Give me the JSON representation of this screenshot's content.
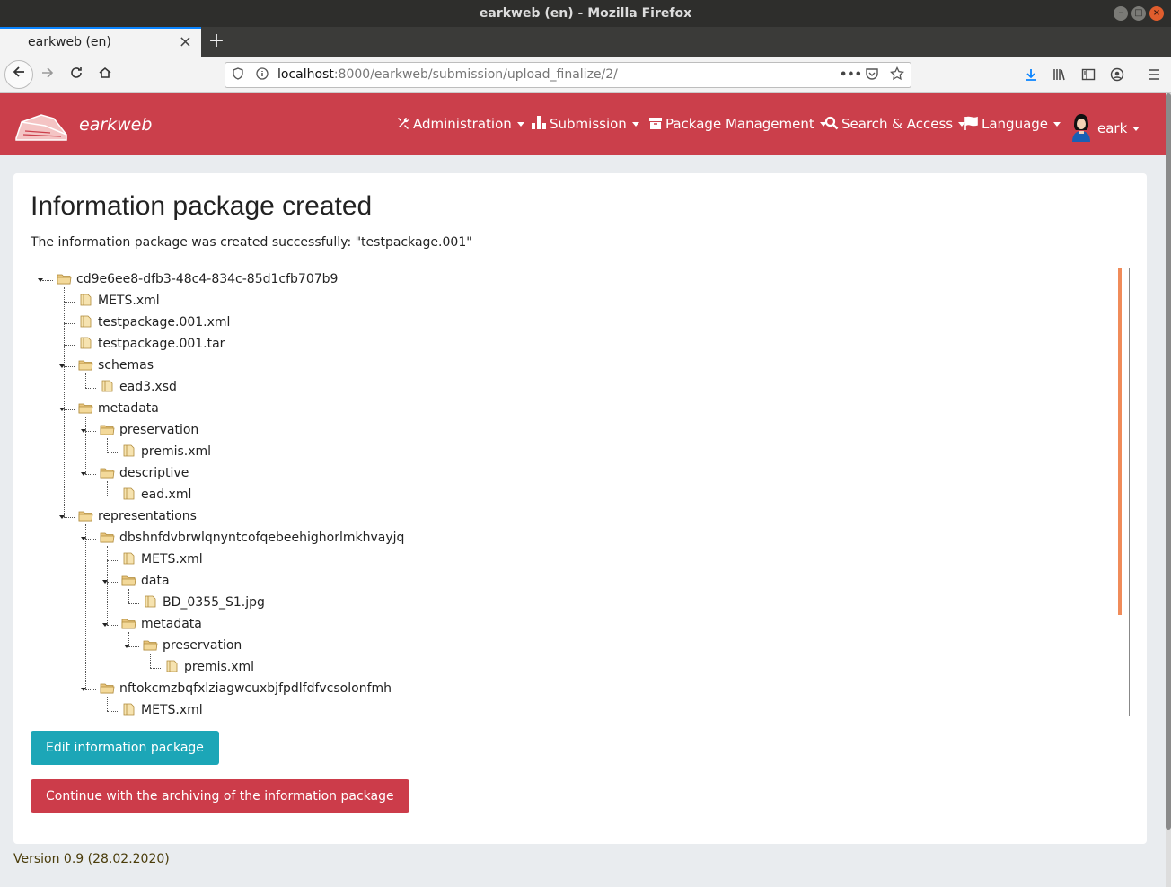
{
  "window": {
    "title": "earkweb (en) - Mozilla Firefox",
    "buttons": [
      "–",
      "□",
      "×"
    ]
  },
  "browser": {
    "tab_title": "earkweb (en)",
    "tab_close": "×",
    "new_tab": "+",
    "url_host": "localhost",
    "url_rest": ":8000/earkweb/submission/upload_finalize/2/",
    "icons": [
      "back-icon",
      "forward-icon",
      "reload-icon",
      "home-icon",
      "shield-icon",
      "info-icon",
      "more-icon",
      "pocket-icon",
      "bookmark-star-icon",
      "download-icon",
      "library-icon",
      "sidebar-icon",
      "account-icon",
      "hamburger-menu-icon"
    ]
  },
  "app": {
    "brand": "earkweb",
    "brand_color": "#cb3f4b",
    "menu": [
      {
        "label": "Administration",
        "icon": "tools-icon"
      },
      {
        "label": "Submission",
        "icon": "submission-icon"
      },
      {
        "label": "Package Management",
        "icon": "archive-box-icon"
      },
      {
        "label": "Search & Access",
        "icon": "search-icon"
      },
      {
        "label": "Language",
        "icon": "flag-icon"
      },
      {
        "label": "eark",
        "icon": "user-avatar-icon"
      }
    ]
  },
  "main": {
    "title": "Information package created",
    "message": "The information package was created successfully: \"testpackage.001\"",
    "tree": [
      {
        "label": "cd9e6ee8-dfb3-48c4-834c-85d1cfb707b9",
        "type": "folder",
        "depth": 0
      },
      {
        "label": "METS.xml",
        "type": "file",
        "depth": 1
      },
      {
        "label": "testpackage.001.xml",
        "type": "file",
        "depth": 1
      },
      {
        "label": "testpackage.001.tar",
        "type": "file",
        "depth": 1
      },
      {
        "label": "schemas",
        "type": "folder",
        "depth": 1
      },
      {
        "label": "ead3.xsd",
        "type": "file",
        "depth": 2
      },
      {
        "label": "metadata",
        "type": "folder",
        "depth": 1
      },
      {
        "label": "preservation",
        "type": "folder",
        "depth": 2
      },
      {
        "label": "premis.xml",
        "type": "file",
        "depth": 3
      },
      {
        "label": "descriptive",
        "type": "folder",
        "depth": 2
      },
      {
        "label": "ead.xml",
        "type": "file",
        "depth": 3
      },
      {
        "label": "representations",
        "type": "folder",
        "depth": 1
      },
      {
        "label": "dbshnfdvbrwlqnyntcofqebeehighorlmkhvayjq",
        "type": "folder",
        "depth": 2
      },
      {
        "label": "METS.xml",
        "type": "file",
        "depth": 3
      },
      {
        "label": "data",
        "type": "folder",
        "depth": 3
      },
      {
        "label": "BD_0355_S1.jpg",
        "type": "file",
        "depth": 4
      },
      {
        "label": "metadata",
        "type": "folder",
        "depth": 3
      },
      {
        "label": "preservation",
        "type": "folder",
        "depth": 4
      },
      {
        "label": "premis.xml",
        "type": "file",
        "depth": 5
      },
      {
        "label": "nftokcmzbqfxlziagwcuxbjfpdlfdfvcsolonfmh",
        "type": "folder",
        "depth": 2
      },
      {
        "label": "METS.xml",
        "type": "file",
        "depth": 3
      }
    ],
    "edit_button": "Edit information package",
    "continue_button": "Continue with the archiving of the information package"
  },
  "footer": {
    "version": "Version 0.9 (28.02.2020)"
  }
}
